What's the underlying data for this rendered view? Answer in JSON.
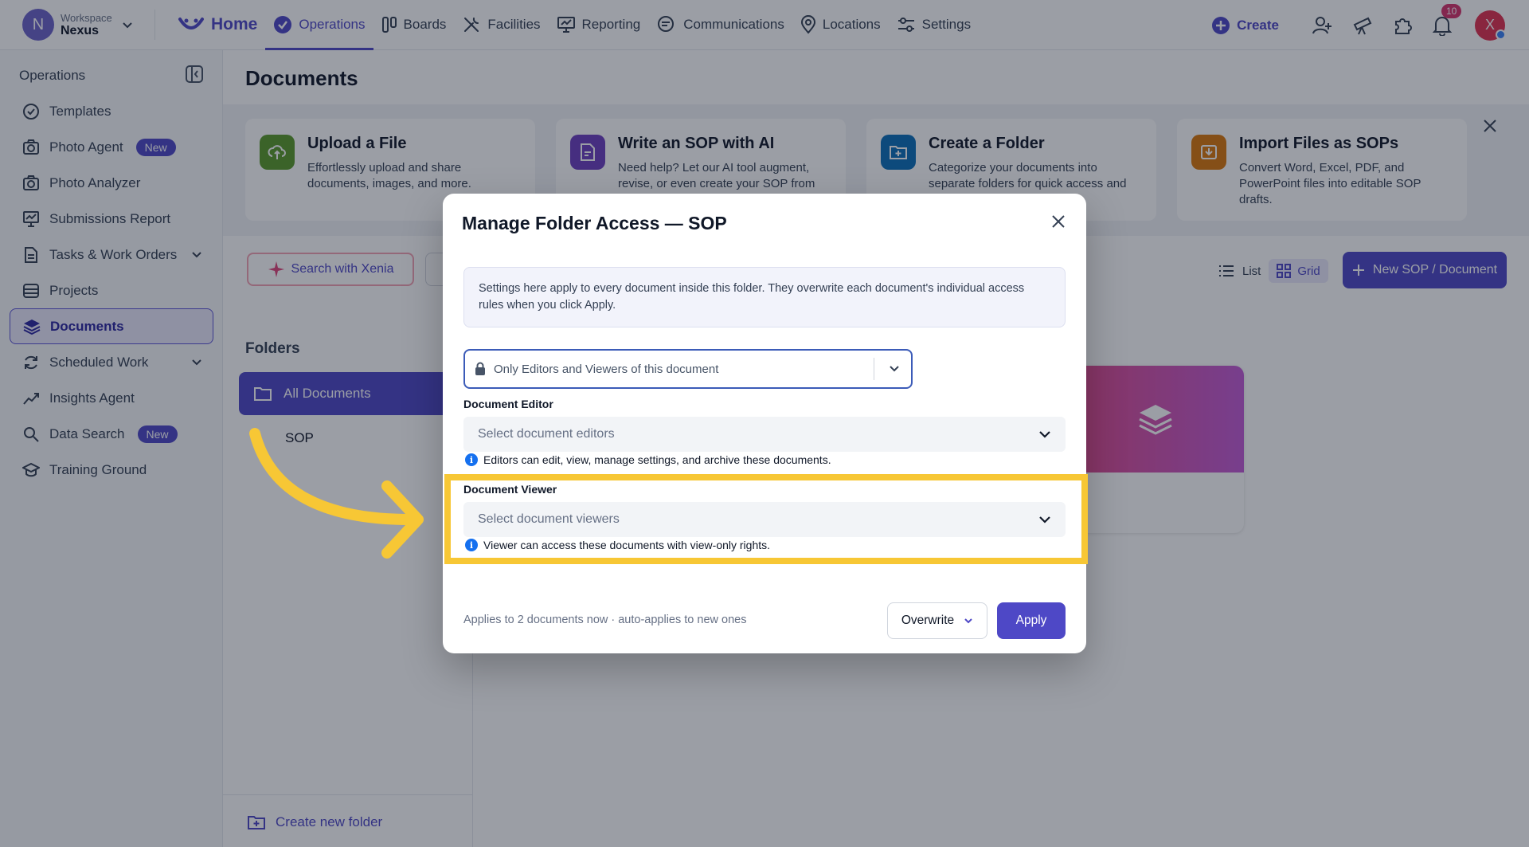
{
  "workspace": {
    "label": "Workspace",
    "name": "Nexus",
    "avatar_letter": "N"
  },
  "topnav": {
    "home": "Home",
    "items": [
      "Operations",
      "Boards",
      "Facilities",
      "Reporting",
      "Communications",
      "Locations",
      "Settings"
    ],
    "active": "Operations",
    "create_label": "Create",
    "notification_count": "10",
    "user_initial": "X"
  },
  "sidebar": {
    "title": "Operations",
    "items": [
      {
        "label": "Templates",
        "icon": "check-circle-icon"
      },
      {
        "label": "Photo Agent",
        "icon": "camera-icon",
        "badge": "New"
      },
      {
        "label": "Photo Analyzer",
        "icon": "camera-icon"
      },
      {
        "label": "Submissions Report",
        "icon": "monitor-icon"
      },
      {
        "label": "Tasks & Work Orders",
        "icon": "document-icon",
        "expandable": true
      },
      {
        "label": "Projects",
        "icon": "projects-icon"
      },
      {
        "label": "Documents",
        "icon": "layers-icon",
        "active": true
      },
      {
        "label": "Scheduled Work",
        "icon": "refresh-icon",
        "expandable": true
      },
      {
        "label": "Insights Agent",
        "icon": "trend-icon"
      },
      {
        "label": "Data Search",
        "icon": "search-icon",
        "badge": "New"
      },
      {
        "label": "Training Ground",
        "icon": "graduation-icon"
      }
    ]
  },
  "main": {
    "page_title": "Documents",
    "quick_cards": [
      {
        "title": "Upload a File",
        "desc": "Effortlessly upload and share documents, images, and more.",
        "color": "#5a9a2a"
      },
      {
        "title": "Write an SOP with AI",
        "desc": "Need help? Let our AI tool augment, revise, or even create your SOP from",
        "color": "#6d3fc0"
      },
      {
        "title": "Create a Folder",
        "desc": "Categorize your documents into separate folders for quick access and",
        "color": "#0b6fb8"
      },
      {
        "title": "Import Files as SOPs",
        "desc": "Convert Word, Excel, PDF, and PowerPoint files into editable SOP drafts.",
        "color": "#d9780c"
      }
    ],
    "search_with_xenia": "Search with Xenia",
    "view_list": "List",
    "view_grid": "Grid",
    "new_sop_button": "New SOP / Document",
    "folders_title": "Folders",
    "folders": [
      "All Documents",
      "SOP"
    ],
    "create_folder": "Create new folder"
  },
  "modal": {
    "title": "Manage Folder Access — SOP",
    "info_text": "Settings here apply to every document inside this folder. They overwrite each document's individual access rules when you click Apply.",
    "access_value": "Only Editors and Viewers of this document",
    "editor_label": "Document Editor",
    "editor_placeholder": "Select document editors",
    "editor_helper": "Editors can edit, view, manage settings, and archive these documents.",
    "viewer_label": "Document Viewer",
    "viewer_placeholder": "Select document viewers",
    "viewer_helper": "Viewer can access these documents with view-only rights.",
    "footer_note": "Applies to 2 documents now · auto-applies to new ones",
    "overwrite_label": "Overwrite",
    "apply_label": "Apply"
  },
  "colors": {
    "accent": "#4e48c6",
    "highlight": "#f7c735",
    "arrow": "#f7c735"
  }
}
